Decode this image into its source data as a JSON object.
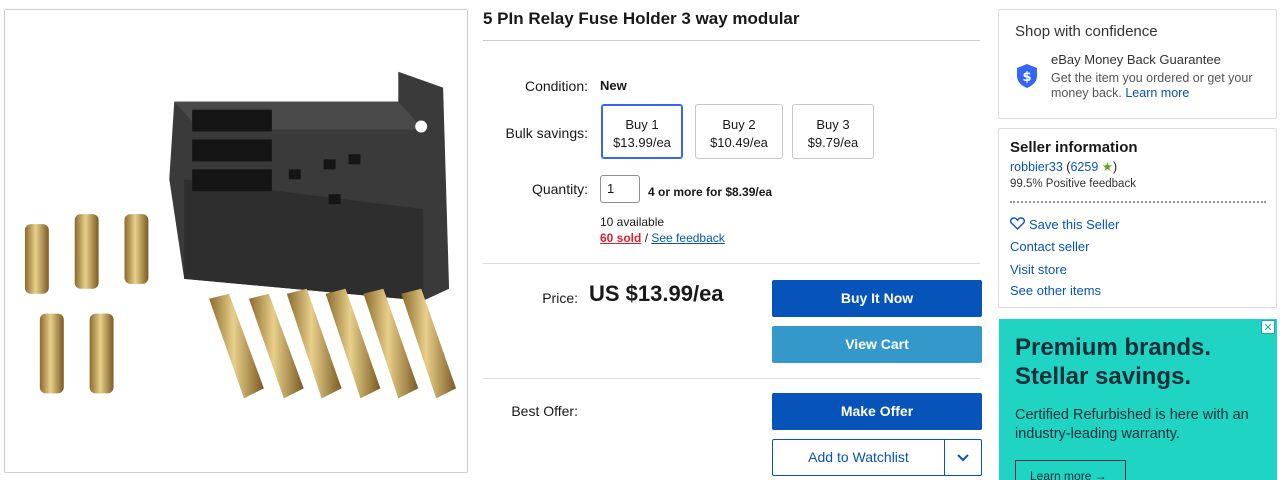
{
  "listing": {
    "title": "5 PIn Relay Fuse Holder 3 way modular",
    "condition_label": "Condition:",
    "condition_value": "New",
    "bulk_label": "Bulk savings:",
    "bulk_options": [
      {
        "line1": "Buy 1",
        "line2": "$13.99/ea",
        "selected": true
      },
      {
        "line1": "Buy 2",
        "line2": "$10.49/ea",
        "selected": false
      },
      {
        "line1": "Buy 3",
        "line2": "$9.79/ea",
        "selected": false
      }
    ],
    "quantity_label": "Quantity:",
    "quantity_value": "1",
    "quantity_note": "4 or more for $8.39/ea",
    "available": "10 available",
    "sold": "60 sold",
    "sold_sep": " / ",
    "feedback_link": "See feedback",
    "price_label": "Price:",
    "price_value": "US $13.99/ea",
    "buy_now": "Buy It Now",
    "view_cart": "View Cart",
    "best_offer_label": "Best Offer:",
    "make_offer": "Make Offer",
    "watchlist": "Add to Watchlist",
    "watch_dropdown_icon": "chevron-down-icon"
  },
  "confidence": {
    "title": "Shop with confidence",
    "guarantee_title": "eBay Money Back Guarantee",
    "guarantee_text": "Get the item you ordered or get your money back.",
    "learn_more": "Learn more",
    "icon": "shield-dollar-icon"
  },
  "seller": {
    "title": "Seller information",
    "name": "robbier33",
    "score_open": " (",
    "score": "6259",
    "score_close": ")",
    "feedback": "99.5% Positive feedback",
    "save": "Save this Seller",
    "contact": "Contact seller",
    "visit": "Visit store",
    "other": "See other items"
  },
  "ad": {
    "headline1": "Premium brands.",
    "headline2": "Stellar savings.",
    "body": "Certified Refurbished is here with an industry-leading warranty.",
    "cta": "Learn more",
    "cta_arrow": "→",
    "close": "✕"
  },
  "colors": {
    "link": "#0654ba",
    "buy_button": "#0654ba",
    "cart_button": "#3498ca",
    "sold": "#dd1e31",
    "ad_bg": "#1fd4c3",
    "star": "#5ba71b"
  }
}
